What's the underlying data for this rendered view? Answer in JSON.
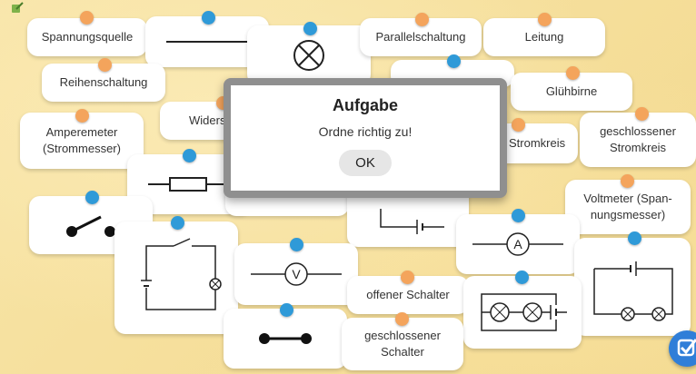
{
  "cards": {
    "spannungsquelle": "Spannungsquelle",
    "reihenschaltung": "Reihenschaltung",
    "amperemeter_line1": "Amperemeter",
    "amperemeter_line2": "(Strommesser)",
    "widerstand": "Widers",
    "parallelschaltung": "Parallelschaltung",
    "leitung": "Leitung",
    "gluehbirne": "Glühbirne",
    "stromkreis": "Stromkreis",
    "geschlossener_stromkreis_line1": "geschlossener",
    "geschlossener_stromkreis_line2": "Stromkreis",
    "voltmeter_line1": "Voltmeter (Span-",
    "voltmeter_line2": "nungsmesser)",
    "offener_schalter": "offener Schalter",
    "geschlossener_schalter_line1": "geschlossener",
    "geschlossener_schalter_line2": "Schalter"
  },
  "symbols": {
    "voltmeter_letter": "V",
    "amperemeter_letter": "A"
  },
  "modal": {
    "title": "Aufgabe",
    "message": "Ordne richtig zu!",
    "ok_label": "OK"
  },
  "colors": {
    "pin_orange": "#f4a45c",
    "pin_blue": "#2f9ad8",
    "check_button": "#2f7ed8",
    "background": "#f6e3a4"
  },
  "icons": {
    "check_button": "checkmark-icon",
    "app": "app-logo-icon"
  }
}
